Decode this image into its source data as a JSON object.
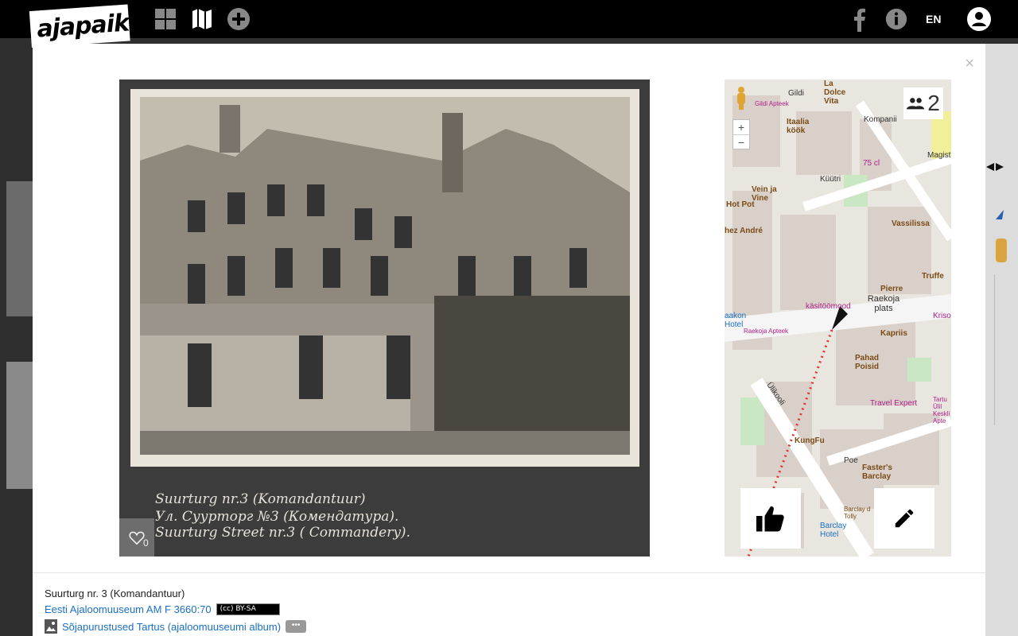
{
  "topbar": {
    "logo": "ajapaik",
    "nav_icons": [
      "grid-icon",
      "map-icon",
      "add-icon"
    ],
    "lang": "EN"
  },
  "modal": {
    "close_label": "×",
    "photo": {
      "caption_lines": [
        "Suurturg nr.3 (Komandantuur)",
        "Ул. Суурторг №3 (Комендатура).",
        "Suurturg Street nr.3 ( Commandery)."
      ],
      "likes": "0"
    },
    "map": {
      "rephoto_count": "2",
      "zoom_in": "+",
      "zoom_out": "−",
      "labels": [
        "Gildi",
        "La Dolce Vita",
        "Itaalia köök",
        "Küütri",
        "Kompanii",
        "Magistri",
        "Vein ja Vine",
        "Hot Pot",
        "hez André",
        "Vassilissa",
        "Truffe",
        "Pierre",
        "Raekoja plats",
        "käsitöömood",
        "Raekoja Apteek",
        "Kapriis",
        "Pahad Poisid",
        "Ülikooli",
        "Travel Expert",
        "KungFu",
        "Poe",
        "Faster's Barclay",
        "Barclay d Tolly",
        "Barclay Hotel",
        "75 cl",
        "Gildi Apteek",
        "aakon Hotel",
        "Kriso",
        "Tartu Ülil Keskli Apte"
      ]
    },
    "info": {
      "title": "Suurturg nr. 3 (Komandantuur)",
      "source": "Eesti Ajaloomuuseum AM F 3660:70",
      "license": "(cc) BY-SA",
      "album": "Sõjapurustused Tartus (ajaloomuuseumi album)",
      "more": "•••"
    }
  }
}
